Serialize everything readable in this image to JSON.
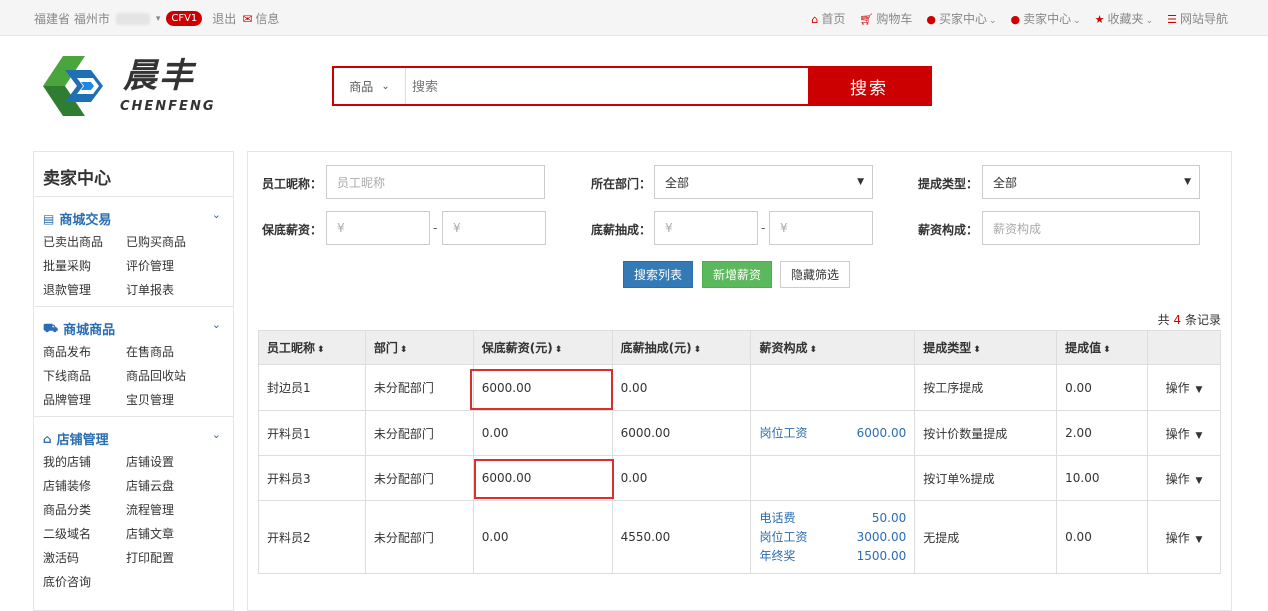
{
  "topbar": {
    "location": "福建省 福州市",
    "badge": "CFV1",
    "logout": "退出",
    "message": "信息",
    "home": "首页",
    "cart": "购物车",
    "buyer": "买家中心",
    "seller": "卖家中心",
    "favorites": "收藏夹",
    "sitemap": "网站导航"
  },
  "logo": {
    "cn": "晨丰",
    "en": "CHENFENG"
  },
  "search": {
    "category": "商品",
    "placeholder": "搜索",
    "button": "搜索"
  },
  "sidebar": {
    "title": "卖家中心",
    "sections": [
      {
        "title": "商城交易",
        "icon": "list-icon",
        "links": [
          "已卖出商品",
          "已购买商品",
          "批量采购",
          "评价管理",
          "退款管理",
          "订单报表"
        ]
      },
      {
        "title": "商城商品",
        "icon": "truck-icon",
        "links": [
          "商品发布",
          "在售商品",
          "下线商品",
          "商品回收站",
          "品牌管理",
          "宝贝管理"
        ]
      },
      {
        "title": "店铺管理",
        "icon": "home-icon",
        "links": [
          "我的店铺",
          "店铺设置",
          "店铺装修",
          "店铺云盘",
          "商品分类",
          "流程管理",
          "二级域名",
          "店铺文章",
          "激活码",
          "打印配置",
          "底价咨询"
        ]
      }
    ]
  },
  "filters": {
    "nickname_label": "员工昵称：",
    "nickname_placeholder": "员工昵称",
    "dept_label": "所在部门：",
    "dept_value": "全部",
    "commission_type_label": "提成类型：",
    "commission_type_value": "全部",
    "base_salary_label": "保底薪资：",
    "currency": "¥",
    "dash": "-",
    "base_comm_label": "底薪抽成：",
    "salary_comp_label": "薪资构成：",
    "salary_comp_placeholder": "薪资构成"
  },
  "buttons": {
    "search": "搜索列表",
    "add": "新增薪资",
    "hide": "隐藏筛选"
  },
  "total": {
    "prefix": "共",
    "count": "4",
    "suffix": "条记录"
  },
  "table": {
    "headers": [
      "员工昵称",
      "部门",
      "保底薪资(元)",
      "底薪抽成(元)",
      "薪资构成",
      "提成类型",
      "提成值",
      ""
    ],
    "rows": [
      {
        "name": "封边员1",
        "dept": "未分配部门",
        "base": "6000.00",
        "commission": "0.00",
        "components": [],
        "type": "按工序提成",
        "value": "0.00",
        "op": "操作"
      },
      {
        "name": "开料员1",
        "dept": "未分配部门",
        "base": "0.00",
        "commission": "6000.00",
        "components": [
          {
            "label": "岗位工资",
            "amount": "6000.00"
          }
        ],
        "type": "按计价数量提成",
        "value": "2.00",
        "op": "操作"
      },
      {
        "name": "开料员3",
        "dept": "未分配部门",
        "base": "6000.00",
        "commission": "0.00",
        "components": [],
        "type": "按订单%提成",
        "value": "10.00",
        "op": "操作"
      },
      {
        "name": "开料员2",
        "dept": "未分配部门",
        "base": "0.00",
        "commission": "4550.00",
        "components": [
          {
            "label": "电话费",
            "amount": "50.00"
          },
          {
            "label": "岗位工资",
            "amount": "3000.00"
          },
          {
            "label": "年终奖",
            "amount": "1500.00"
          }
        ],
        "type": "无提成",
        "value": "0.00",
        "op": "操作"
      }
    ]
  },
  "colors": {
    "accent": "#cc0000",
    "link": "#2a6db2",
    "btn_primary": "#337ab7",
    "btn_success": "#5cb85c",
    "highlight": "#d9302d"
  }
}
